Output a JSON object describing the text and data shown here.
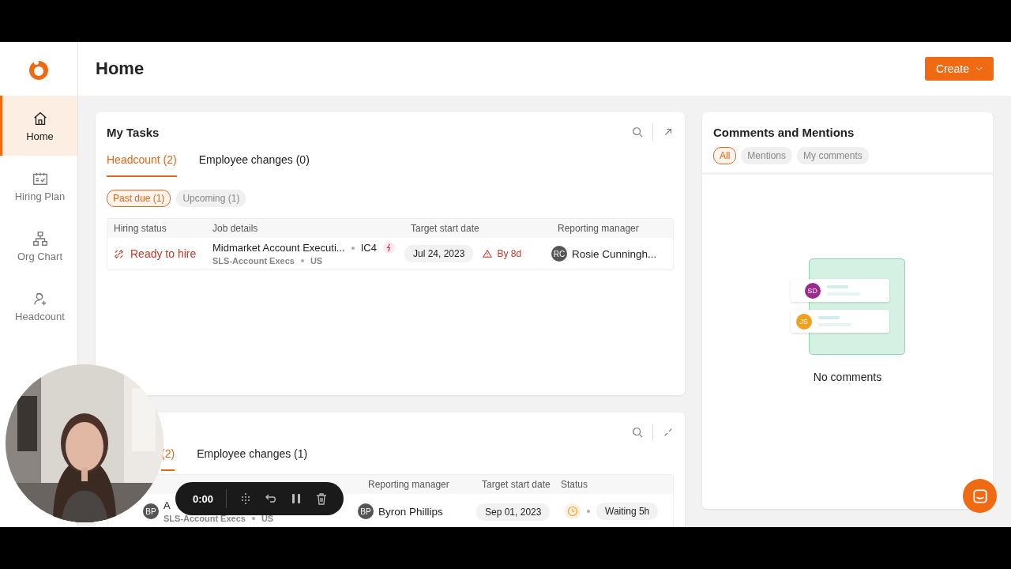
{
  "sidebar": {
    "items": [
      {
        "label": "Home",
        "selected": true
      },
      {
        "label": "Hiring Plan",
        "selected": false
      },
      {
        "label": "Org Chart",
        "selected": false
      },
      {
        "label": "Headcount",
        "selected": false
      }
    ]
  },
  "header": {
    "title": "Home",
    "create_button": "Create"
  },
  "my_tasks": {
    "title": "My Tasks",
    "tabs": [
      {
        "label": "Headcount (2)",
        "selected": true
      },
      {
        "label": "Employee changes (0)",
        "selected": false
      }
    ],
    "filters": [
      {
        "label": "Past due (1)",
        "selected": true
      },
      {
        "label": "Upcoming (1)",
        "selected": false
      }
    ],
    "columns": [
      "Hiring status",
      "Job details",
      "Target start date",
      "Reporting manager"
    ],
    "rows": [
      {
        "status": "Ready to hire",
        "job": "Midmarket Account Executi...",
        "level": "IC4",
        "team": "SLS-Account Execs",
        "location": "US",
        "date": "Jul 24, 2023",
        "due": "By 8d",
        "manager_initials": "RC",
        "manager": "Rosie Cunningh..."
      }
    ]
  },
  "second_card": {
    "tabs": [
      {
        "label": "(2)",
        "selected": true
      },
      {
        "label": "Employee changes (1)",
        "selected": false
      }
    ],
    "columns": [
      "Reporting manager",
      "Target start date",
      "Status"
    ],
    "rows": [
      {
        "initials": "BP",
        "job": "A",
        "team": "SLS-Account Execs",
        "location": "US",
        "manager_initials": "BP",
        "manager": "Byron Phillips",
        "date": "Sep 01, 2023",
        "status": "Waiting 5h"
      }
    ]
  },
  "comments": {
    "title": "Comments and Mentions",
    "filters": [
      {
        "label": "All",
        "selected": true
      },
      {
        "label": "Mentions",
        "selected": false
      },
      {
        "label": "My comments",
        "selected": false
      }
    ],
    "illustration_avatars": [
      {
        "initials": "SD",
        "color": "#9b2a8c"
      },
      {
        "initials": "JS",
        "color": "#f0a020"
      }
    ],
    "empty_text": "No comments"
  },
  "recorder": {
    "time": "0:00"
  }
}
